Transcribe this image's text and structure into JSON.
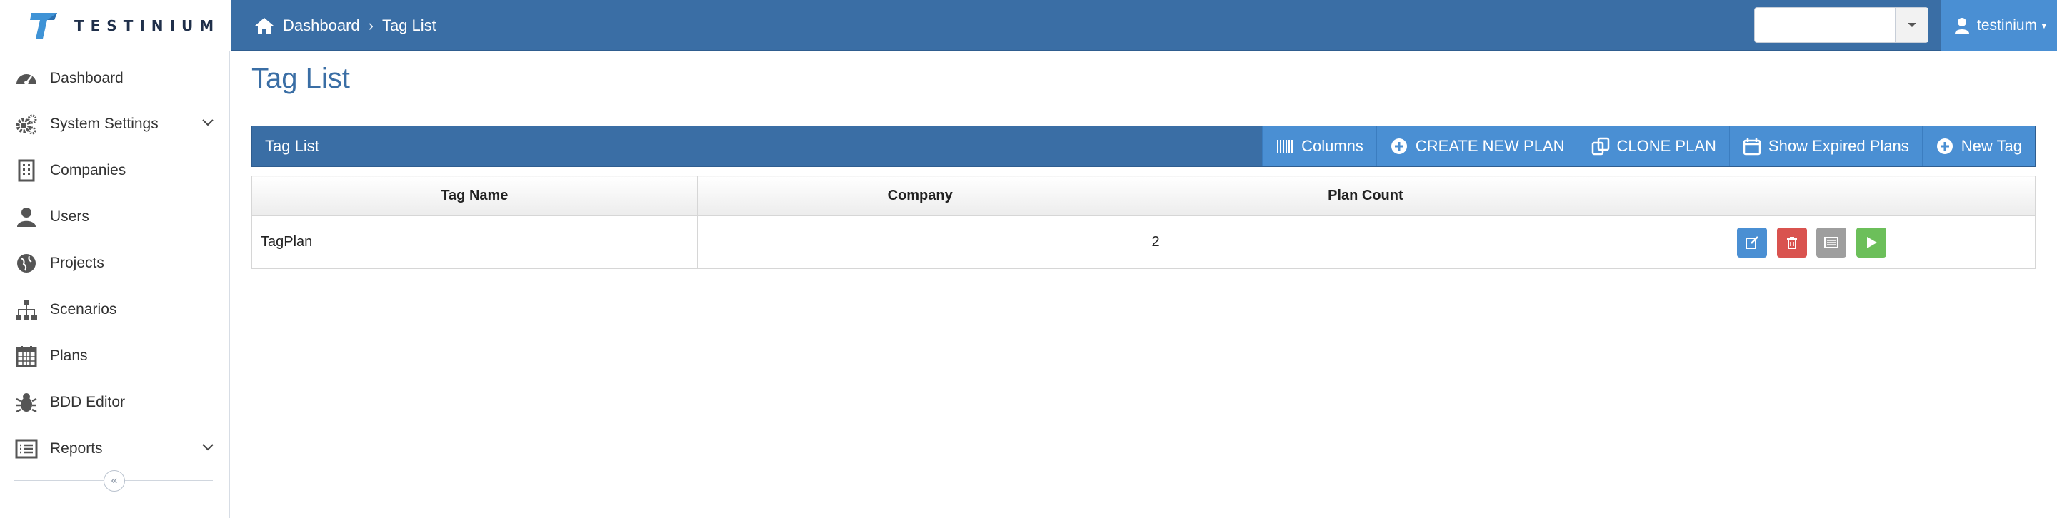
{
  "brand": {
    "wordmark": "TESTINIUM"
  },
  "breadcrumb": {
    "home": "Dashboard",
    "current": "Tag List"
  },
  "top_select": {
    "value": ""
  },
  "user": {
    "name": "testinium"
  },
  "sidebar": {
    "items": [
      {
        "label": "Dashboard",
        "icon": "dashboard-icon"
      },
      {
        "label": "System Settings",
        "icon": "cogs-icon"
      },
      {
        "label": "Companies",
        "icon": "building-icon"
      },
      {
        "label": "Users",
        "icon": "user-icon"
      },
      {
        "label": "Projects",
        "icon": "globe-icon"
      },
      {
        "label": "Scenarios",
        "icon": "sitemap-icon"
      },
      {
        "label": "Plans",
        "icon": "calendar-icon"
      },
      {
        "label": "BDD Editor",
        "icon": "bug-icon"
      },
      {
        "label": "Reports",
        "icon": "list-icon"
      }
    ]
  },
  "main": {
    "title": "Tag List",
    "panel_title": "Tag List",
    "toolbar": {
      "columns": "Columns",
      "create_plan": "CREATE NEW PLAN",
      "clone_plan": "CLONE PLAN",
      "show_expired": "Show Expired Plans",
      "new_tag": "New Tag"
    },
    "table": {
      "headers": [
        "Tag Name",
        "Company",
        "Plan Count",
        ""
      ],
      "rows": [
        {
          "tag_name": "TagPlan",
          "company": "",
          "plan_count": "2"
        }
      ]
    }
  },
  "colors": {
    "primary": "#3a6ea5",
    "accent": "#4a8fd3",
    "danger": "#d9534f",
    "success": "#6cbf5a",
    "neutral": "#9e9e9e"
  }
}
